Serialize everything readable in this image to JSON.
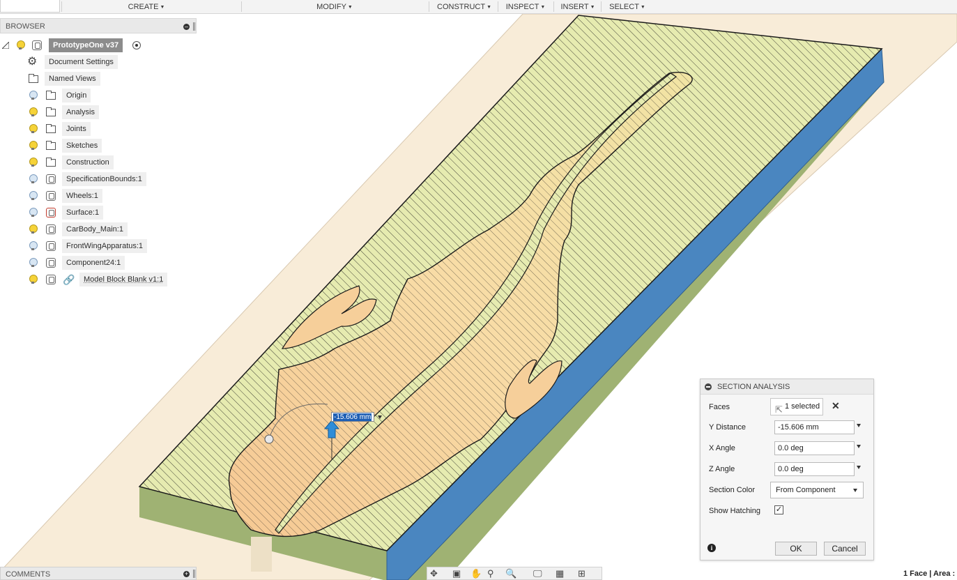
{
  "toolbar": {
    "menus": [
      {
        "label": "CREATE"
      },
      {
        "label": "MODIFY"
      },
      {
        "label": "CONSTRUCT"
      },
      {
        "label": "INSPECT"
      },
      {
        "label": "INSERT"
      },
      {
        "label": "SELECT"
      }
    ]
  },
  "browser": {
    "title": "BROWSER",
    "root": {
      "label": "PrototypeOne v37"
    },
    "items": [
      {
        "label": "Document Settings",
        "icon": "gear-icon"
      },
      {
        "label": "Named Views",
        "icon": "folder-icon"
      },
      {
        "label": "Origin",
        "icon": "folder-icon",
        "visibility": "off"
      },
      {
        "label": "Analysis",
        "icon": "folder-icon",
        "visibility": "on"
      },
      {
        "label": "Joints",
        "icon": "folder-icon",
        "visibility": "on"
      },
      {
        "label": "Sketches",
        "icon": "folder-icon",
        "visibility": "on"
      },
      {
        "label": "Construction",
        "icon": "folder-icon",
        "visibility": "on"
      },
      {
        "label": "SpecificationBounds:1",
        "icon": "component-icon",
        "visibility": "off"
      },
      {
        "label": "Wheels:1",
        "icon": "component-icon",
        "visibility": "off"
      },
      {
        "label": "Surface:1",
        "icon": "component-icon",
        "visibility": "off"
      },
      {
        "label": "CarBody_Main:1",
        "icon": "component-icon",
        "visibility": "on"
      },
      {
        "label": "FrontWingApparatus:1",
        "icon": "component-icon",
        "visibility": "off"
      },
      {
        "label": "Component24:1",
        "icon": "component-icon",
        "visibility": "off"
      },
      {
        "label": "Model Block Blank v1:1",
        "icon": "linked-component-icon",
        "visibility": "on"
      }
    ]
  },
  "comments": {
    "title": "COMMENTS"
  },
  "status": {
    "text": "1 Face | Area :"
  },
  "manipulator": {
    "value": "-15.606 mm"
  },
  "section_analysis": {
    "title": "SECTION ANALYSIS",
    "faces": {
      "label": "Faces",
      "value": "1 selected"
    },
    "y_distance": {
      "label": "Y Distance",
      "value": "-15.606 mm"
    },
    "x_angle": {
      "label": "X Angle",
      "value": "0.0 deg"
    },
    "z_angle": {
      "label": "Z Angle",
      "value": "0.0 deg"
    },
    "section_color": {
      "label": "Section Color",
      "value": "From Component"
    },
    "show_hatching": {
      "label": "Show Hatching",
      "checked": true
    },
    "ok_label": "OK",
    "cancel_label": "Cancel"
  },
  "colors": {
    "section_face": "#e6ebb0",
    "part_section": "#f6cf9a",
    "block_side": "#4a86c0",
    "block_front": "#9fb273",
    "ground_plane": "#f8ecd8",
    "highlight": "#1f5fb4"
  }
}
